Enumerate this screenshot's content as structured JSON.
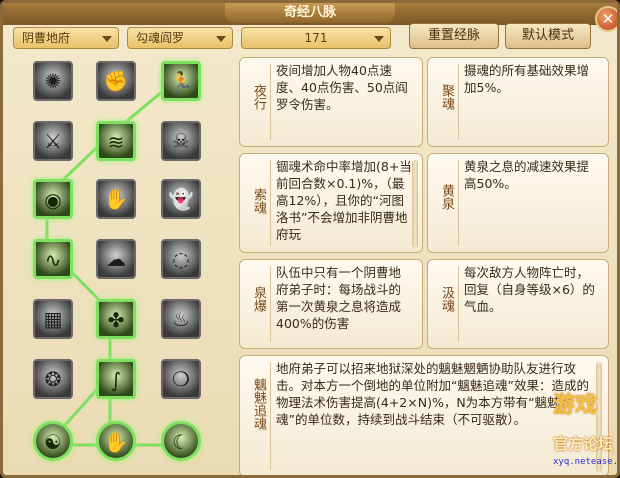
{
  "window": {
    "title": "奇经八脉",
    "close_label": "✕"
  },
  "toolbar": {
    "school_select": "阴曹地府",
    "branch_select": "勾魂阎罗",
    "points_value": "171",
    "reset_button": "重置经脉",
    "default_button": "默认模式"
  },
  "tree": {
    "nodes": [
      {
        "icon": "whirl-icon",
        "glyph": "✺",
        "active": false
      },
      {
        "icon": "fist-icon",
        "glyph": "✊",
        "active": false
      },
      {
        "icon": "runner-icon",
        "glyph": "🏃",
        "active": true
      },
      {
        "icon": "sword-icon",
        "glyph": "⚔",
        "active": false
      },
      {
        "icon": "wave-icon",
        "glyph": "≋",
        "active": true
      },
      {
        "icon": "skull-pair-icon",
        "glyph": "☠",
        "active": false
      },
      {
        "icon": "eye-icon",
        "glyph": "◉",
        "active": true
      },
      {
        "icon": "claw-icon",
        "glyph": "✋",
        "active": false
      },
      {
        "icon": "ghost-icon",
        "glyph": "👻",
        "active": false
      },
      {
        "icon": "swirl-icon",
        "glyph": "∿",
        "active": true
      },
      {
        "icon": "spirit-icon",
        "glyph": "☁",
        "active": false
      },
      {
        "icon": "vortex-icon",
        "glyph": "◌",
        "active": false
      },
      {
        "icon": "cage-icon",
        "glyph": "▦",
        "active": false
      },
      {
        "icon": "knot-icon",
        "glyph": "✤",
        "active": true
      },
      {
        "icon": "flame-icon",
        "glyph": "♨",
        "active": false
      },
      {
        "icon": "tornado-icon",
        "glyph": "❂",
        "active": false
      },
      {
        "icon": "serpent-icon",
        "glyph": "∫",
        "active": true
      },
      {
        "icon": "phantom-icon",
        "glyph": "❍",
        "active": false
      },
      {
        "icon": "dragon-orb-icon",
        "glyph": "☯",
        "active": true
      },
      {
        "icon": "scroll-icon",
        "glyph": "✋",
        "active": true
      },
      {
        "icon": "moon-orb-icon",
        "glyph": "☾",
        "active": true
      }
    ]
  },
  "cards": {
    "yexing": {
      "name": "夜行",
      "desc": "夜间增加人物40点速度、40点伤害、50点阎罗令伤害。"
    },
    "juhun": {
      "name": "聚魂",
      "desc": "摄魂的所有基础效果增加5%。"
    },
    "suohun": {
      "name": "索魂",
      "desc": "锢魂术命中率增加(8+当前回合数×0.1)%，（最高12%），且你的“河图洛书”不会增加非阴曹地府玩"
    },
    "huangquan": {
      "name": "黄泉",
      "desc": "黄泉之息的减速效果提高50%。"
    },
    "quanbao": {
      "name": "泉爆",
      "desc": "队伍中只有一个阴曹地府弟子时：每场战斗的第一次黄泉之息将造成400%的伤害"
    },
    "jihun": {
      "name": "汲魂",
      "desc": "每次敌方人物阵亡时，回复（自身等级×6）的气血。"
    },
    "chimei": {
      "name": "魑魅追魂",
      "desc": "地府弟子可以招来地狱深处的魑魅魍魉协助队友进行攻击。对本方一个倒地的单位附加“魑魅追魂”效果：造成的物理法术伤害提高(4+2×N)%，N为本方带有“魑魅追魂”的单位数，持续到战斗结束（不可驱散）。"
    }
  },
  "watermark": {
    "line1": "游戏",
    "line2": "官方论坛",
    "line3": "xyq.netease.com"
  }
}
